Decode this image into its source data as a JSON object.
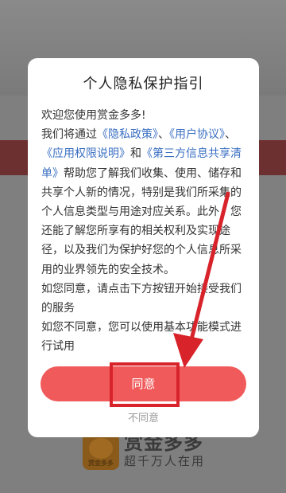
{
  "background": {
    "app_name": "赏金多多",
    "slogan": "超千万人在用",
    "logo_text": "赏金多多"
  },
  "dialog": {
    "title": "个人隐私保护指引",
    "greeting": "欢迎您使用赏金多多!",
    "p2": {
      "t1": "我们将通过",
      "link1": "《隐私政策》",
      "t2": "、",
      "link2": "《用户协议》",
      "t3": "、",
      "link3": "《应用权限说明》",
      "t4": "和",
      "link4": "《第三方信息共享清单》",
      "t5": "帮助您了解我们收集、使用、储存和共享个人新的情况，特别是我们所采集的个人信息类型与用途对应关系。此外，您还能了解您所享有的相关权利及实现途径，以及我们为保护好您的个人信息所采用的业界领先的安全技术。"
    },
    "p3": "如您同意，请点击下方按钮开始接受我们的服务",
    "p4": "如您不同意，您可以使用基本功能模式进行试用",
    "agree_label": "同意",
    "disagree_label": "不同意"
  },
  "colors": {
    "accent": "#f05a5a",
    "link": "#3a6fc2",
    "annotation": "#d8232a"
  }
}
